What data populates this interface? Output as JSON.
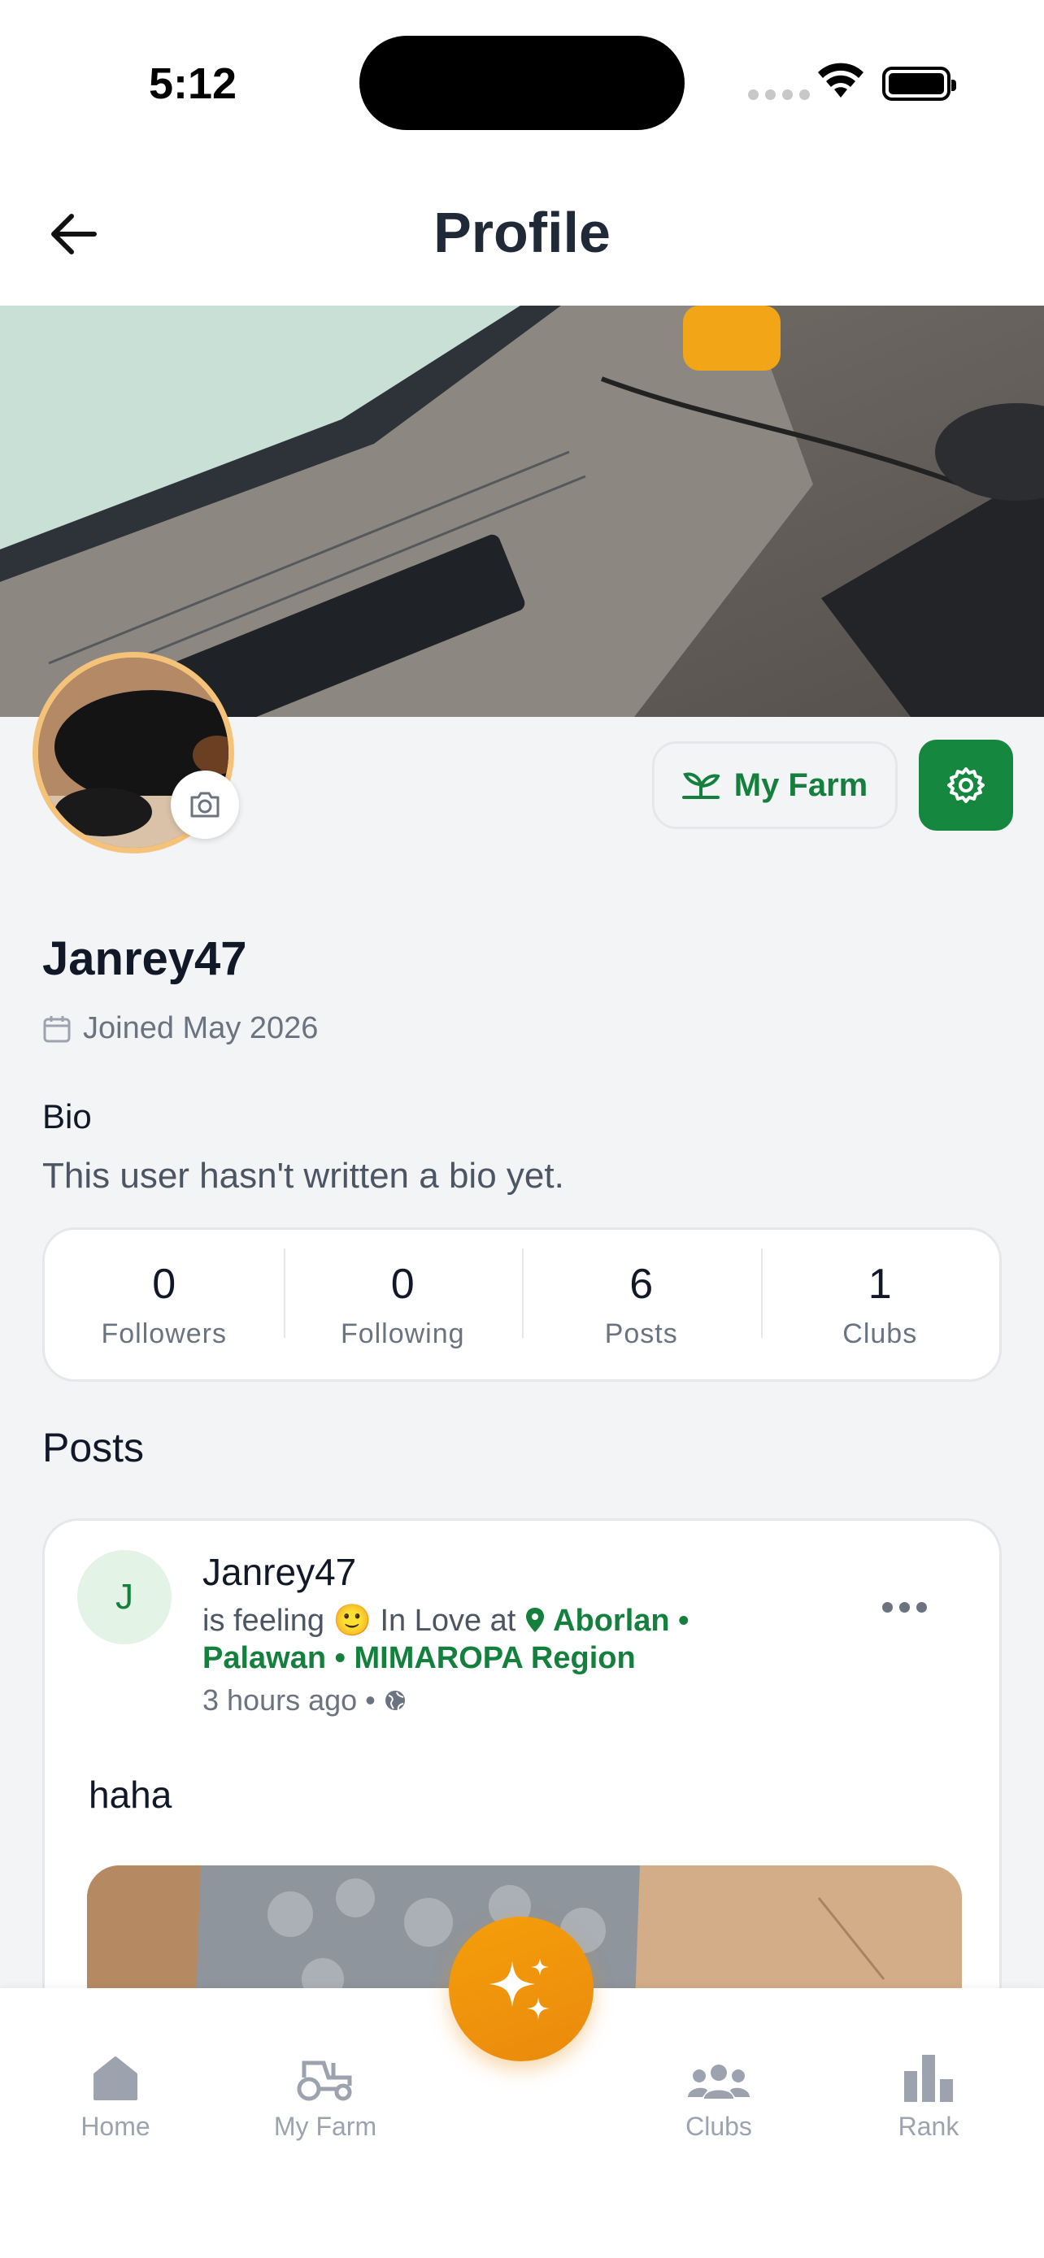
{
  "status_bar": {
    "time": "5:12"
  },
  "header": {
    "title": "Profile"
  },
  "actions": {
    "my_farm_label": "My Farm"
  },
  "profile": {
    "username": "Janrey47",
    "joined": "Joined May 2026",
    "bio_label": "Bio",
    "bio_text": "This user hasn't written a bio yet."
  },
  "stats": [
    {
      "value": "0",
      "label": "Followers"
    },
    {
      "value": "0",
      "label": "Following"
    },
    {
      "value": "6",
      "label": "Posts"
    },
    {
      "value": "1",
      "label": "Clubs"
    }
  ],
  "posts_heading": "Posts",
  "post": {
    "avatar_initial": "J",
    "author": "Janrey47",
    "feeling_prefix": "is feeling",
    "feeling_emoji": "🙂",
    "feeling": "In Love at",
    "location": "Aborlan • Palawan • MIMAROPA Region",
    "time": "3 hours ago",
    "separator": "•",
    "body": "haha"
  },
  "nav": {
    "home": "Home",
    "my_farm": "My Farm",
    "clubs": "Clubs",
    "rank": "Rank"
  },
  "icons": {
    "back": "arrow-left-icon",
    "camera": "camera-icon",
    "sprout": "sprout-icon",
    "settings": "gear-icon",
    "calendar": "calendar-icon",
    "pin": "map-pin-icon",
    "globe": "globe-icon",
    "more": "more-horizontal-icon",
    "sparkles": "sparkles-icon"
  },
  "colors": {
    "accent_green": "#16873f",
    "fab_orange": "#f59e0b",
    "avatar_ring": "#f5c27a"
  }
}
